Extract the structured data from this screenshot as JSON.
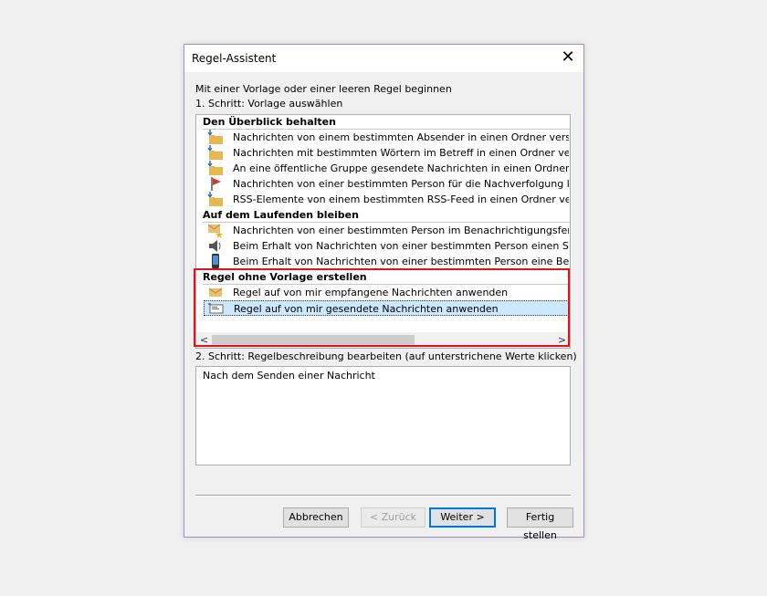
{
  "dialog": {
    "title": "Regel-Assistent",
    "close_glyph": "✕",
    "intro": "Mit einer Vorlage oder einer leeren Regel beginnen",
    "step1": "1. Schritt: Vorlage auswählen",
    "step2": "2. Schritt: Regelbeschreibung bearbeiten (auf unterstrichene Werte klicken)",
    "description_text": "Nach dem Senden einer Nachricht"
  },
  "groups": [
    {
      "header": "Den Überblick behalten",
      "items": [
        {
          "label": "Nachrichten von einem bestimmten Absender in einen Ordner verschieben",
          "icon": "move-folder-icon"
        },
        {
          "label": "Nachrichten mit bestimmten Wörtern im Betreff in einen Ordner verschieben",
          "icon": "move-folder-icon"
        },
        {
          "label": "An eine öffentliche Gruppe gesendete Nachrichten in einen Ordner verschieben",
          "icon": "move-folder-icon"
        },
        {
          "label": "Nachrichten von einer bestimmten Person für die Nachverfolgung kennzeichnen",
          "icon": "flag-icon"
        },
        {
          "label": "RSS-Elemente von einem bestimmten RSS-Feed in einen Ordner verschieben",
          "icon": "move-folder-icon"
        }
      ]
    },
    {
      "header": "Auf dem Laufenden bleiben",
      "items": [
        {
          "label": "Nachrichten von einer bestimmten Person im Benachrichtigungsfenster anzeigen",
          "icon": "mail-star-icon"
        },
        {
          "label": "Beim Erhalt von Nachrichten von einer bestimmten Person einen Sound wiedergeben",
          "icon": "speaker-icon"
        },
        {
          "label": "Beim Erhalt von Nachrichten von einer bestimmten Person eine Benachrichtigung senden",
          "icon": "phone-icon"
        }
      ]
    },
    {
      "header": "Regel ohne Vorlage erstellen",
      "items": [
        {
          "label": "Regel auf von mir empfangene Nachrichten anwenden",
          "icon": "envelope-icon"
        },
        {
          "label": "Regel auf von mir gesendete Nachrichten anwenden",
          "icon": "sent-mail-icon",
          "selected": true
        }
      ]
    }
  ],
  "scrollbar": {
    "left_arrow": "<",
    "right_arrow": ">"
  },
  "buttons": {
    "cancel": "Abbrechen",
    "back": "< Zurück",
    "next": "Weiter >",
    "finish": "Fertig stellen"
  },
  "colors": {
    "highlight_border": "#e0141e",
    "selection_bg": "#cce8ff",
    "default_button_border": "#0078d7"
  }
}
